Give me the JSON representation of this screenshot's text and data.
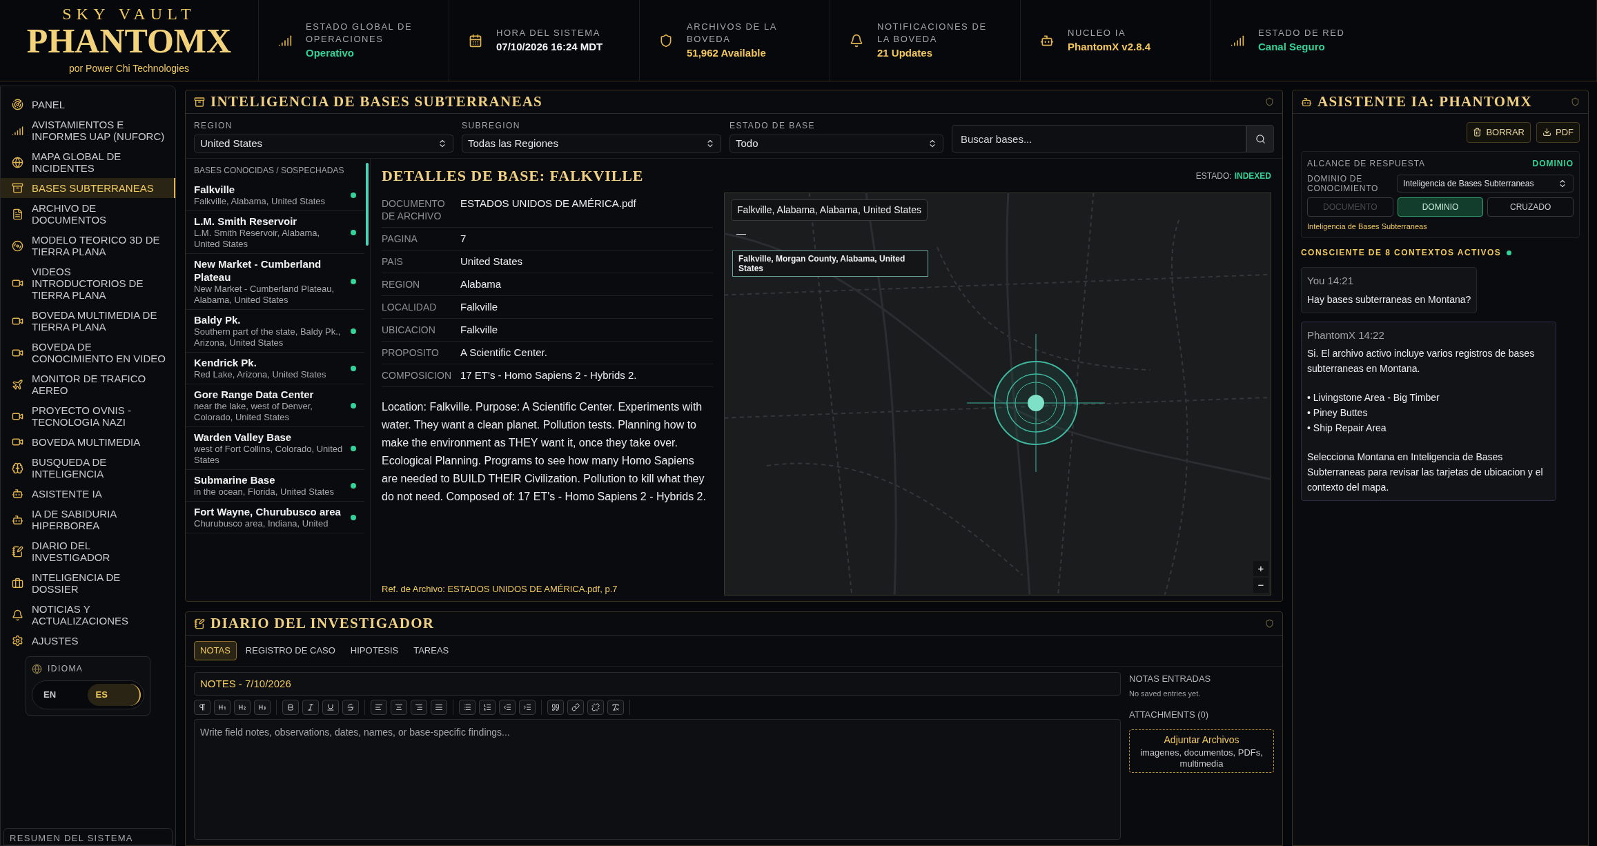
{
  "header": {
    "brand_top": "SKY VAULT",
    "brand": "PHANTOMX",
    "brand_sub": "por Power Chi Technologies",
    "stats": [
      {
        "kind": "signal",
        "label": "ESTADO GLOBAL DE OPERACIONES",
        "value": "Operativo",
        "color": "#34d399"
      },
      {
        "kind": "calendar",
        "label": "HORA DEL SISTEMA",
        "value": "07/10/2026 16:24 MDT",
        "color": "#f3f4f6"
      },
      {
        "kind": "shield",
        "label": "ARCHIVOS DE LA BOVEDA",
        "value": "51,962 Available",
        "color": "#f2c75c"
      },
      {
        "kind": "bell",
        "label": "NOTIFICACIONES DE LA BOVEDA",
        "value": "21 Updates",
        "color": "#f2c75c"
      },
      {
        "kind": "bot",
        "label": "NUCLEO IA",
        "value": "PhantomX v2.8.4",
        "color": "#f2c75c"
      },
      {
        "kind": "signal",
        "label": "ESTADO DE RED",
        "value": "Canal Seguro",
        "color": "#34d399"
      }
    ]
  },
  "sidebar": {
    "items": [
      {
        "kind": "radar",
        "label": "PANEL",
        "selected": false
      },
      {
        "kind": "signal",
        "label": "AVISTAMIENTOS E INFORMES UAP (NUFORC)",
        "selected": false
      },
      {
        "kind": "globe",
        "label": "MAPA GLOBAL DE INCIDENTES",
        "selected": false
      },
      {
        "kind": "archive",
        "label": "BASES SUBTERRANEAS",
        "selected": true
      },
      {
        "kind": "file",
        "label": "ARCHIVO DE DOCUMENTOS",
        "selected": false
      },
      {
        "kind": "disc",
        "label": "MODELO TEORICO 3D DE TIERRA PLANA",
        "selected": false
      },
      {
        "kind": "video",
        "label": "VIDEOS INTRODUCTORIOS DE TIERRA PLANA",
        "selected": false
      },
      {
        "kind": "video",
        "label": "BOVEDA MULTIMEDIA DE TIERRA PLANA",
        "selected": false
      },
      {
        "kind": "video",
        "label": "BOVEDA DE CONOCIMIENTO EN VIDEO",
        "selected": false
      },
      {
        "kind": "plane",
        "label": "MONITOR DE TRAFICO AEREO",
        "selected": false
      },
      {
        "kind": "video",
        "label": "PROYECTO OVNIS - TECNOLOGIA NAZI",
        "selected": false
      },
      {
        "kind": "video",
        "label": "BOVEDA MULTIMEDIA",
        "selected": false
      },
      {
        "kind": "brain",
        "label": "BUSQUEDA DE INTELIGENCIA",
        "selected": false
      },
      {
        "kind": "bot",
        "label": "ASISTENTE IA",
        "selected": false
      },
      {
        "kind": "bot",
        "label": "IA DE SABIDURIA HIPERBOREA",
        "selected": false
      },
      {
        "kind": "notebook",
        "label": "DIARIO DEL INVESTIGADOR",
        "selected": false
      },
      {
        "kind": "briefcase",
        "label": "INTELIGENCIA DE DOSSIER",
        "selected": false
      },
      {
        "kind": "bell",
        "label": "NOTICIAS Y ACTUALIZACIONES",
        "selected": false
      },
      {
        "kind": "settings",
        "label": "AJUSTES",
        "selected": false
      }
    ],
    "language": {
      "title": "IDIOMA",
      "options": [
        {
          "label": "EN",
          "selected": false
        },
        {
          "label": "ES",
          "selected": true
        }
      ]
    },
    "footer": "RESUMEN DEL SISTEMA"
  },
  "bases_panel": {
    "title": "INTELIGENCIA DE BASES SUBTERRANEAS",
    "filters": [
      {
        "label": "REGION",
        "value": "United States"
      },
      {
        "label": "SUBREGION",
        "value": "Todas las Regiones"
      },
      {
        "label": "ESTADO DE BASE",
        "value": "Todo"
      }
    ],
    "search": {
      "placeholder": "Buscar bases..."
    },
    "list_title": "BASES CONOCIDAS / SOSPECHADAS",
    "bases": [
      {
        "name": "Falkville",
        "location": "Falkville, Alabama, United States"
      },
      {
        "name": "L.M. Smith Reservoir",
        "location": "L.M. Smith Reservoir, Alabama, United States"
      },
      {
        "name": "New Market - Cumberland Plateau",
        "location": "New Market - Cumberland Plateau, Alabama, United States"
      },
      {
        "name": "Baldy Pk.",
        "location": "Southern part of the state, Baldy Pk., Arizona, United States"
      },
      {
        "name": "Kendrick Pk.",
        "location": "Red Lake, Arizona, United States"
      },
      {
        "name": "Gore Range Data Center",
        "location": "near the lake, west of Denver, Colorado, United States"
      },
      {
        "name": "Warden Valley Base",
        "location": "west of Fort Collins, Colorado, United States"
      },
      {
        "name": "Submarine Base",
        "location": "in the ocean, Florida, United States"
      },
      {
        "name": "Fort Wayne, Churubusco area",
        "location": "Churubusco area, Indiana, United"
      }
    ],
    "detail": {
      "title": "DETALLES DE BASE: FALKVILLE",
      "status_label": "ESTADO:",
      "status": "INDEXED",
      "fields": [
        {
          "label": "DOCUMENTO DE ARCHIVO",
          "value": "ESTADOS UNIDOS DE AMÉRICA.pdf"
        },
        {
          "label": "PAGINA",
          "value": "7"
        },
        {
          "label": "PAIS",
          "value": "United States"
        },
        {
          "label": "REGION",
          "value": "Alabama"
        },
        {
          "label": "LOCALIDAD",
          "value": "Falkville"
        },
        {
          "label": "UBICACION",
          "value": "Falkville"
        },
        {
          "label": "PROPOSITO",
          "value": "A Scientific Center."
        },
        {
          "label": "COMPOSICION",
          "value": "17 ET's - Homo Sapiens 2 - Hybrids 2."
        }
      ],
      "description": "Location: Falkville. Purpose: A Scientific Center. Experiments with water. They want a clean planet. Pollution tests. Planning how to make the environment as THEY want it, once they take over. Ecological Planning. Programs to see how many Homo Sapiens are needed to BUILD THEIR Civilization. Pollution to kill what they do not need. Composed of: 17 ET's - Homo Sapiens 2 - Hybrids 2.",
      "reference": "Ref. de Archivo: ESTADOS UNIDOS DE AMÉRICA.pdf, p.7"
    },
    "map": {
      "tooltip": "Falkville, Alabama, Alabama, United States",
      "collapse": "—",
      "popup": "Falkville, Morgan County, Alabama, United States",
      "zoom_in": "+",
      "zoom_out": "−"
    }
  },
  "assistant": {
    "title": "ASISTENTE IA: PHANTOMX",
    "actions": [
      {
        "kind": "trash",
        "label": "BORRAR"
      },
      {
        "kind": "download",
        "label": "PDF"
      }
    ],
    "scope": {
      "title": "ALCANCE DE RESPUESTA",
      "current": "DOMINIO",
      "domain_label": "DOMINIO DE CONOCIMIENTO",
      "domain_value": "Inteligencia de Bases Subterraneas",
      "modes": [
        {
          "label": "DOCUMENTO",
          "selected": false,
          "disabled": true
        },
        {
          "label": "DOMINIO",
          "selected": true,
          "disabled": false
        },
        {
          "label": "CRUZADO",
          "selected": false,
          "disabled": false
        }
      ],
      "note": "Inteligencia de Bases Subterraneas"
    },
    "contexts": "CONSCIENTE DE 8 CONTEXTOS ACTIVOS",
    "messages": [
      {
        "kind": "user",
        "author": "You 14:21",
        "paragraphs": [
          [
            "Hay bases subterraneas en Montana?"
          ]
        ]
      },
      {
        "kind": "assistant",
        "author": "PhantomX 14:22",
        "paragraphs": [
          [
            "Si. El archivo activo incluye varios registros de bases subterraneas en Montana."
          ],
          [
            "• Livingstone Area - Big Timber",
            "• Piney Buttes",
            "• Ship Repair Area"
          ],
          [
            "Selecciona Montana en Inteligencia de Bases Subterraneas para revisar las tarjetas de ubicacion y el contexto del mapa."
          ]
        ]
      }
    ]
  },
  "journal": {
    "title": "DIARIO DEL INVESTIGADOR",
    "tabs": [
      {
        "label": "NOTAS",
        "selected": true
      },
      {
        "label": "REGISTRO DE CASO",
        "selected": false
      },
      {
        "label": "HIPOTESIS",
        "selected": false
      },
      {
        "label": "TAREAS",
        "selected": false
      }
    ],
    "note_title": "NOTES - 7/10/2026",
    "editor_placeholder": "Write field notes, observations, dates, names, or base-specific findings...",
    "entries_title": "NOTAS ENTRADAS",
    "entries_empty": "No saved entries yet.",
    "attachments_title": "ATTACHMENTS (0)",
    "upload": {
      "title": "Adjuntar Archivos",
      "hint": "imagenes, documentos, PDFs, multimedia"
    }
  }
}
